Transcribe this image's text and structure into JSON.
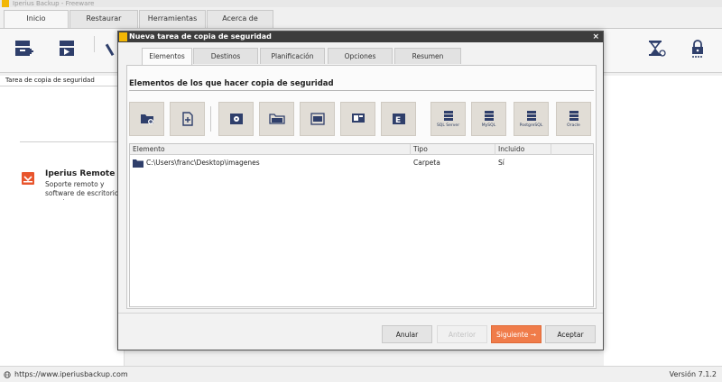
{
  "app": {
    "title": "Iperius Backup - Freeware",
    "tabs": [
      "Inicio",
      "Restaurar",
      "Herramientas",
      "Acerca de"
    ],
    "active_tab": "Inicio",
    "left_panel_header": "Tarea de copia de seguridad",
    "remote": {
      "title": "Iperius Remote",
      "description": "Soporte remoto y software de escritorio remoto"
    },
    "status": {
      "url": "https://www.iperiusbackup.com",
      "version": "Versión 7.1.2"
    }
  },
  "dialog": {
    "title": "Nueva tarea de copia de seguridad",
    "close_label": "×",
    "tabs": [
      "Elementos",
      "Destinos",
      "Planificación",
      "Opciones",
      "Resumen"
    ],
    "active_tab": "Elementos",
    "heading": "Elementos de los que hacer copia de seguridad",
    "toolbar": {
      "sql_server": "SQL Server",
      "mysql": "MySQL",
      "postgresql": "PostgreSQL",
      "oracle": "Oracle"
    },
    "table": {
      "columns": [
        "Elemento",
        "Tipo",
        "Incluido"
      ],
      "rows": [
        {
          "element": "C:\\Users\\franc\\Desktop\\imagenes",
          "type": "Carpeta",
          "included": "Sí"
        }
      ]
    },
    "buttons": {
      "cancel": "Anular",
      "back": "Anterior",
      "next": "Siguiente",
      "next_arrow": "→",
      "accept": "Aceptar"
    }
  },
  "colors": {
    "accent": "#f07c4a",
    "dialog_title_bg": "#3d3d3d",
    "icon_navy": "#2f3f6b",
    "icon_tile": "#e1ddd6",
    "remote_brand": "#e8552d"
  }
}
